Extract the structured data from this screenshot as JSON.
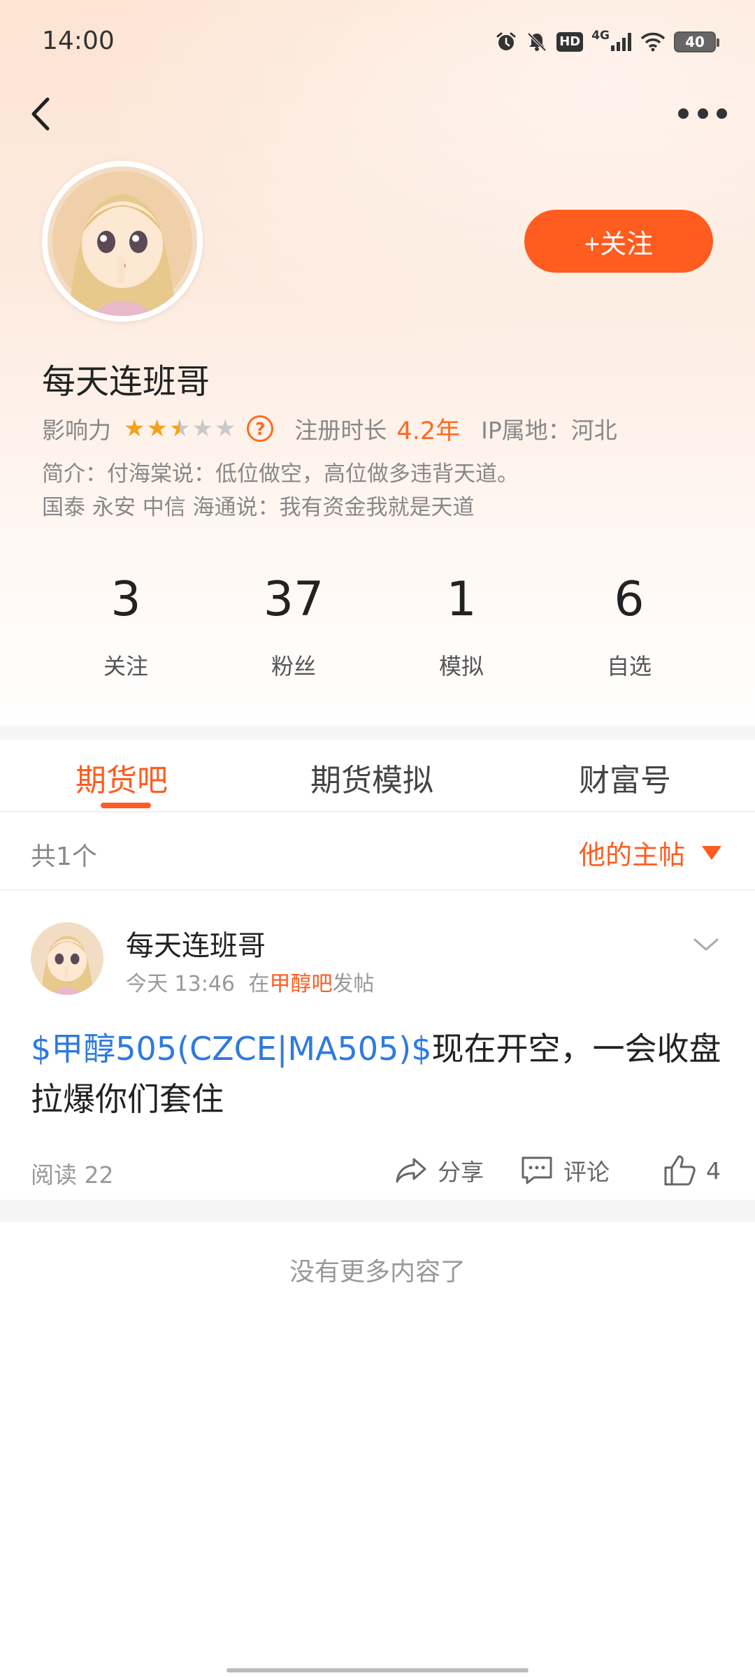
{
  "status_bar": {
    "time": "14:00",
    "network": "4G",
    "hd": "HD",
    "battery": "40"
  },
  "profile": {
    "username": "每天连班哥",
    "follow_label": "+关注",
    "influence_label": "影响力",
    "influence_stars": 2.5,
    "influence_max": 5,
    "help_symbol": "?",
    "reg_label": "注册时长",
    "reg_value": "4.2年",
    "ip_label": "IP属地：河北",
    "intro_line1": "简介：付海棠说：低位做空，高位做多违背天道。",
    "intro_line2": "国泰 永安 中信 海通说：我有资金我就是天道"
  },
  "stats": [
    {
      "value": "3",
      "label": "关注"
    },
    {
      "value": "37",
      "label": "粉丝"
    },
    {
      "value": "1",
      "label": "模拟"
    },
    {
      "value": "6",
      "label": "自选"
    }
  ],
  "tabs": [
    {
      "label": "期货吧",
      "active": true
    },
    {
      "label": "期货模拟",
      "active": false
    },
    {
      "label": "财富号",
      "active": false
    }
  ],
  "list_header": {
    "count_text": "共1个",
    "sort_label": "他的主帖"
  },
  "post": {
    "author": "每天连班哥",
    "time": "今天 13:46",
    "in_text": "在",
    "bar_name": "甲醇吧",
    "posted_text": "发帖",
    "stock_tag": "$甲醇505(CZCE|MA505)$",
    "body": "现在开空，一会收盘拉爆你们套住",
    "read_label": "阅读 22",
    "share_label": "分享",
    "comment_label": "评论",
    "like_count": "4"
  },
  "footer": {
    "no_more": "没有更多内容了"
  },
  "colors": {
    "accent": "#ff5c1f",
    "link": "#2d7ae0",
    "star": "#f2a21b"
  },
  "icons": [
    "back-icon",
    "more-icon",
    "alarm-icon",
    "mute-icon",
    "wifi-icon",
    "signal-icon",
    "battery-icon",
    "help-icon",
    "star-icon",
    "chevron-down-icon",
    "share-icon",
    "comment-icon",
    "like-icon",
    "sort-caret-icon"
  ]
}
